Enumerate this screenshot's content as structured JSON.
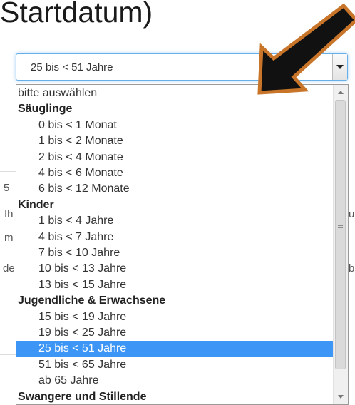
{
  "title_text": "Startdatum)",
  "select": {
    "value": "25 bis < 51 Jahre"
  },
  "background_fragments": {
    "f1": "5",
    "f2": "Ih",
    "f3": "m",
    "f4": "de",
    "f5": "u",
    "f6": "b"
  },
  "options": [
    {
      "label": "bitte auswählen",
      "kind": "plain"
    },
    {
      "label": "Säuglinge",
      "kind": "group"
    },
    {
      "label": "0 bis < 1 Monat",
      "kind": "child"
    },
    {
      "label": "1 bis < 2 Monate",
      "kind": "child"
    },
    {
      "label": "2 bis < 4 Monate",
      "kind": "child"
    },
    {
      "label": "4 bis < 6 Monate",
      "kind": "child"
    },
    {
      "label": "6 bis < 12 Monate",
      "kind": "child"
    },
    {
      "label": "Kinder",
      "kind": "group"
    },
    {
      "label": "1 bis < 4 Jahre",
      "kind": "child"
    },
    {
      "label": "4 bis < 7 Jahre",
      "kind": "child"
    },
    {
      "label": "7 bis < 10 Jahre",
      "kind": "child"
    },
    {
      "label": "10 bis < 13 Jahre",
      "kind": "child"
    },
    {
      "label": "13 bis < 15 Jahre",
      "kind": "child"
    },
    {
      "label": "Jugendliche & Erwachsene",
      "kind": "group"
    },
    {
      "label": "15 bis < 19 Jahre",
      "kind": "child"
    },
    {
      "label": "19 bis < 25 Jahre",
      "kind": "child"
    },
    {
      "label": "25 bis < 51 Jahre",
      "kind": "child",
      "selected": true
    },
    {
      "label": "51 bis < 65 Jahre",
      "kind": "child"
    },
    {
      "label": "ab 65 Jahre",
      "kind": "child"
    },
    {
      "label": "Swangere und Stillende",
      "kind": "group"
    }
  ],
  "colors": {
    "selection": "#3d96f5",
    "annotation_arrow_fill": "#111111",
    "annotation_arrow_outline": "#c8752a",
    "focus_border": "#66afe9"
  },
  "icons": {
    "dropdown": "chevron-down-icon",
    "annotation": "pointer-arrow-icon"
  }
}
